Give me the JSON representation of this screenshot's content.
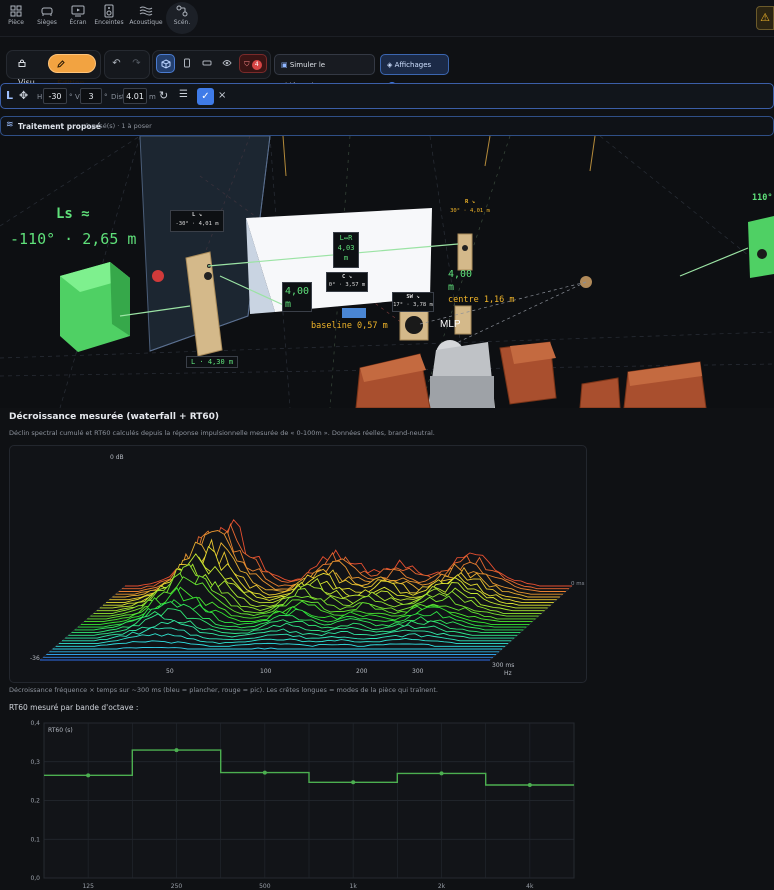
{
  "nav": {
    "items": [
      {
        "label": "Pièce",
        "icon": "grid-icon"
      },
      {
        "label": "Sièges",
        "icon": "seat-icon"
      },
      {
        "label": "Écran",
        "icon": "screen-icon"
      },
      {
        "label": "Enceintes",
        "icon": "speaker-icon"
      },
      {
        "label": "Acoustique",
        "icon": "waves-icon"
      },
      {
        "label": "Scén.",
        "icon": "scenario-icon"
      }
    ],
    "warning_icon": "warning-icon"
  },
  "toolbar": {
    "mode_visu": "Visu",
    "mode_edition": "Édition",
    "alert_count": "4",
    "simulate_label": "Simuler le vidéoprojecteur",
    "display_label": "Affichages",
    "display_count": "4"
  },
  "position": {
    "channel": "L",
    "h_label": "H",
    "h_value": "-30",
    "v_label": "V",
    "v_value": "3",
    "deg": "°",
    "dist_label": "Dist",
    "dist_value": "4.01",
    "dist_unit": "m"
  },
  "treatment": {
    "title": "Traitement proposé",
    "status": "0 posé(s) · 1 à poser"
  },
  "scene": {
    "ls_title": "Ls ≈",
    "ls_value": "-110° · 2,65 m",
    "l_tag_name": "L ↘",
    "l_tag_val": "-30° · 4,01 m",
    "r_tag_name": "R ↘",
    "r_tag_val": "30° · 4,01 m",
    "lr_tag": "L↔R",
    "lr_val": "4,03",
    "lr_unit": "m",
    "c_tag_name": "C ↘",
    "c_tag_val": "0° · 3,57 m",
    "sw_tag_name": "SW ↘",
    "sw_tag_val": "17° · 3,78 m",
    "dist_left": "4,00",
    "dist_left_unit": "m",
    "dist_right": "4,00",
    "dist_right_unit": "m",
    "centre": "centre 1,16 m",
    "baseline": "baseline 0,57 m",
    "mlp": "MLP",
    "l_bottom": "L · 4,30 m",
    "rs_label": "110°"
  },
  "waterfall": {
    "title": "Décroissance mesurée (waterfall + RT60)",
    "description": "Déclin spectral cumulé et RT60 calculés depuis la réponse impulsionnelle mesurée de « 0-100m ». Données réelles, brand-neutral.",
    "top_label": "0 dB",
    "bottom_label": "-36",
    "ms_label": "0 ms",
    "ticks": [
      "50",
      "100",
      "200",
      "300"
    ],
    "axis_end": "300 ms",
    "axis_unit": "Hz",
    "caption": "Décroissance fréquence × temps sur ~300 ms (bleu = plancher, rouge = pic). Les crêtes longues = modes de la pièce qui traînent."
  },
  "rt60": {
    "title": "RT60 mesuré par bande d'octave :"
  },
  "chart_data": {
    "type": "line",
    "title": "",
    "xlabel": "",
    "ylabel": "RT60 (s)",
    "step": true,
    "categories": [
      "125",
      "250",
      "500",
      "1k",
      "2k",
      "4k"
    ],
    "values": [
      0.265,
      0.33,
      0.272,
      0.247,
      0.27,
      0.24
    ],
    "yticks": [
      "0,0",
      "0,1",
      "0,2",
      "0,3",
      "0,4"
    ],
    "ylim": [
      0,
      0.4
    ],
    "grid": true,
    "color": "#4caf50"
  }
}
